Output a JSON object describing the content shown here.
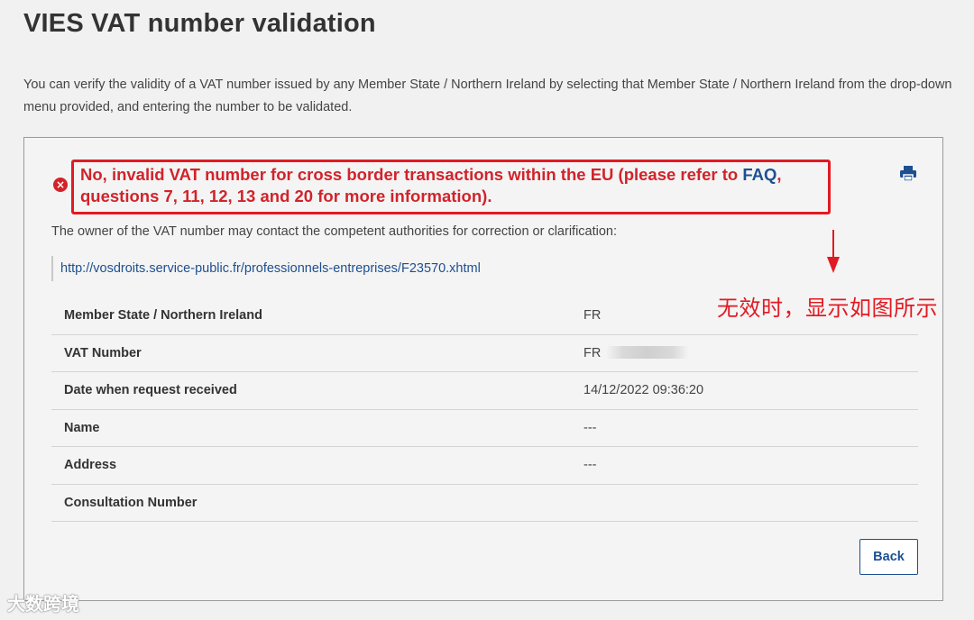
{
  "page": {
    "title": "VIES VAT number validation",
    "intro": "You can verify the validity of a VAT number issued by any Member State / Northern Ireland by selecting that Member State / Northern Ireland from the drop-down menu provided, and entering the number to be validated."
  },
  "result": {
    "error_icon": "error-circle-icon",
    "message_part1": "No, invalid VAT number for cross border transactions within the EU (please refer to ",
    "faq_link": "FAQ",
    "message_part2": ", questions 7, 11, 12, 13 and 20 for more information).",
    "print_icon": "printer-icon",
    "owner_text": "The owner of the VAT number may contact the competent authorities for correction or clarification:",
    "authority_link": "http://vosdroits.service-public.fr/professionnels-entreprises/F23570.xhtml"
  },
  "annotation": {
    "text": "无效时，显示如图所示",
    "color": "#e21a22"
  },
  "details": [
    {
      "label": "Member State / Northern Ireland",
      "value": "FR"
    },
    {
      "label": "VAT Number",
      "value": "FR"
    },
    {
      "label": "Date when request received",
      "value": "14/12/2022 09:36:20"
    },
    {
      "label": "Name",
      "value": "---"
    },
    {
      "label": "Address",
      "value": "---"
    },
    {
      "label": "Consultation Number",
      "value": ""
    }
  ],
  "actions": {
    "back_label": "Back"
  },
  "watermark": {
    "text": "大数跨境"
  },
  "colors": {
    "error": "#d2232a",
    "link": "#1d4f91",
    "background": "#f1f1f1"
  }
}
